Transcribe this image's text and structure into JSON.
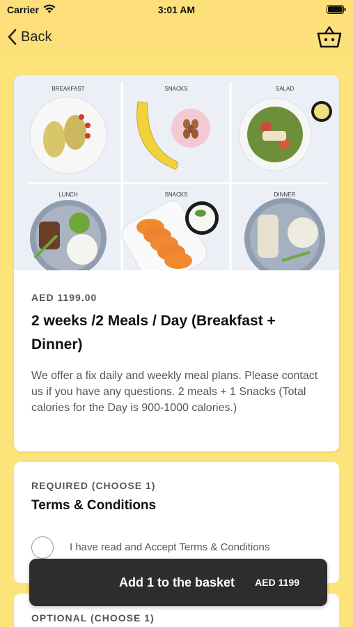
{
  "status_bar": {
    "carrier": "Carrier",
    "time": "3:01 AM"
  },
  "nav": {
    "back_label": "Back",
    "basket_icon": "basket-icon"
  },
  "product": {
    "image_sections": [
      "BREAKFAST",
      "SNACKS",
      "SALAD",
      "LUNCH",
      "SNACKS",
      "DINNER"
    ],
    "price": "AED 1199.00",
    "title": "2 weeks /2 Meals / Day (Breakfast + Dinner)",
    "description": "We offer a fix daily and weekly meal plans. Please contact us if you have any questions. 2 meals + 1 Snacks (Total calories for the Day is 900-1000 calories.)"
  },
  "terms": {
    "section_label": "REQUIRED (CHOOSE 1)",
    "heading": "Terms & Conditions",
    "option_label": "I have read and Accept Terms & Conditions",
    "checked": false
  },
  "optional": {
    "section_label": "OPTIONAL (CHOOSE 1)"
  },
  "basket_bar": {
    "label": "Add 1 to the basket",
    "price": "AED 1199"
  },
  "colors": {
    "background": "#fde47a",
    "bar": "#2d2d2d",
    "card": "#ffffff"
  }
}
